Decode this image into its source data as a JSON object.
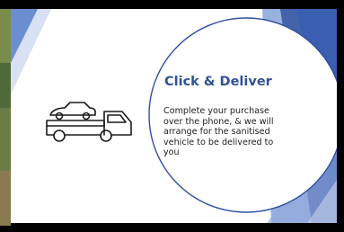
{
  "slide": {
    "title": "Click & Deliver",
    "body": "Complete your purchase over the phone, & we will arrange for the sanitised vehicle to be delivered to you"
  },
  "icons": {
    "delivery": "car-on-tow-truck-icon"
  },
  "colors": {
    "title": "#2f5496",
    "accent_blue": "#4472c4",
    "dark_blue": "#2f4f9e",
    "light_blue": "#8fa9dc",
    "background": "#ffffff",
    "frame": "#000000"
  }
}
